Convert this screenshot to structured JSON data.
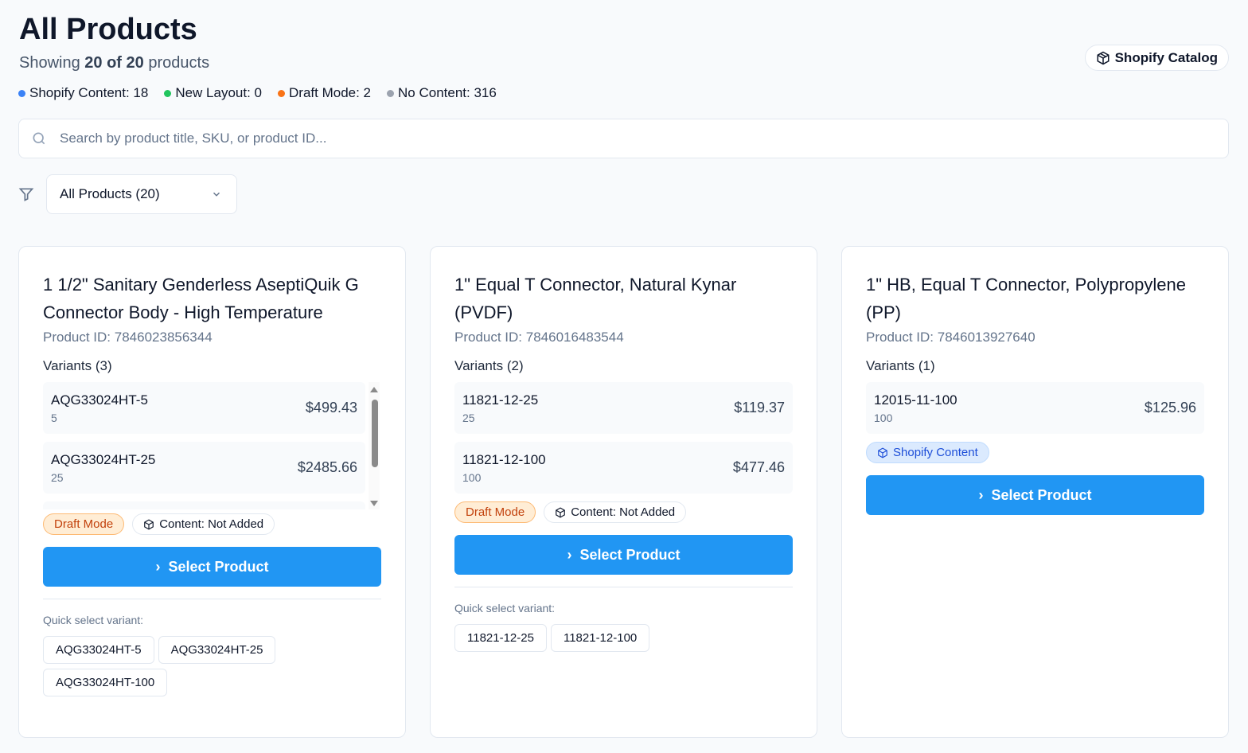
{
  "header": {
    "title": "All Products",
    "showing_prefix": "Showing",
    "shown": "20",
    "of": "of",
    "total": "20",
    "suffix": "products",
    "catalog_button": "Shopify Catalog"
  },
  "legend": [
    {
      "label": "Shopify Content: 18",
      "color": "#3b82f6"
    },
    {
      "label": "New Layout: 0",
      "color": "#22c55e"
    },
    {
      "label": "Draft Mode: 2",
      "color": "#f97316"
    },
    {
      "label": "No Content: 316",
      "color": "#9ca3af"
    }
  ],
  "search": {
    "placeholder": "Search by product title, SKU, or product ID..."
  },
  "filter": {
    "selected": "All Products (20)"
  },
  "products": [
    {
      "title": "1 1/2\" Sanitary Genderless AseptiQuik G Connector Body - High Temperature",
      "product_id": "Product ID: 7846023856344",
      "variants_label": "Variants (3)",
      "variants": [
        {
          "sku": "AQG33024HT-5",
          "qty": "5",
          "price": "$499.43"
        },
        {
          "sku": "AQG33024HT-25",
          "qty": "25",
          "price": "$2485.66"
        }
      ],
      "badges": [
        "Draft Mode",
        "Content: Not Added"
      ],
      "select_label": "Select Product",
      "quick_label": "Quick select variant:",
      "quick": [
        "AQG33024HT-5",
        "AQG33024HT-25",
        "AQG33024HT-100"
      ]
    },
    {
      "title": "1\" Equal T Connector, Natural Kynar (PVDF)",
      "product_id": "Product ID: 7846016483544",
      "variants_label": "Variants (2)",
      "variants": [
        {
          "sku": "11821-12-25",
          "qty": "25",
          "price": "$119.37"
        },
        {
          "sku": "11821-12-100",
          "qty": "100",
          "price": "$477.46"
        }
      ],
      "badges": [
        "Draft Mode",
        "Content: Not Added"
      ],
      "select_label": "Select Product",
      "quick_label": "Quick select variant:",
      "quick": [
        "11821-12-25",
        "11821-12-100"
      ]
    },
    {
      "title": "1\" HB, Equal T Connector, Polypropylene (PP)",
      "product_id": "Product ID: 7846013927640",
      "variants_label": "Variants (1)",
      "variants": [
        {
          "sku": "12015-11-100",
          "qty": "100",
          "price": "$125.96"
        }
      ],
      "badges": [
        "Shopify Content"
      ],
      "select_label": "Select Product"
    }
  ]
}
